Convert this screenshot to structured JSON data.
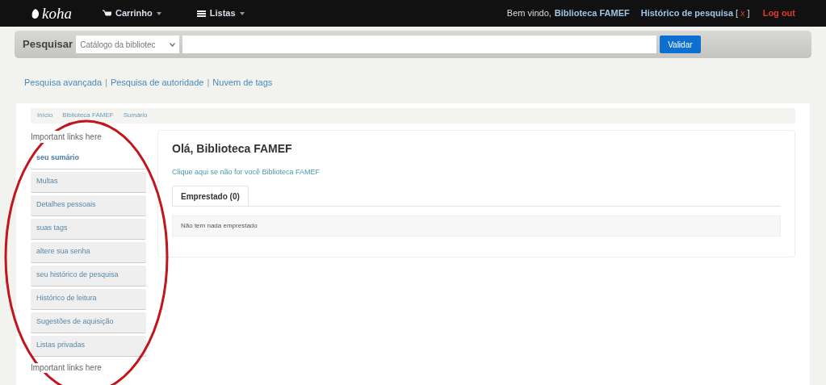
{
  "navbar": {
    "logo": "koha",
    "menus": [
      {
        "label": "Carrinho",
        "kind": "cart"
      },
      {
        "label": "Listas",
        "kind": "list"
      }
    ],
    "welcome": "Bem vindo,",
    "user": "Biblioteca FAMEF",
    "history": "Histórico de pesquisa",
    "history_clear_open": "[",
    "history_clear": "x",
    "history_clear_close": "]",
    "logout": "Log out"
  },
  "search": {
    "label": "Pesquisar",
    "scope": "Catálogo da bibliotec",
    "button": "Validar"
  },
  "search_links": [
    {
      "label": "Pesquisa avançada"
    },
    {
      "label": "Pesquisa de autoridade"
    },
    {
      "label": "Nuvem de tags"
    }
  ],
  "search_link_separator": "|",
  "breadcrumbs": [
    "Início",
    "Biblioteca FAMEF",
    "Sumário"
  ],
  "sidebar": {
    "heading": "Important links here",
    "items": [
      {
        "label": "seu sumário",
        "selected": true
      },
      {
        "label": "Multas",
        "selected": false
      },
      {
        "label": "Detalhes pessoais",
        "selected": false
      },
      {
        "label": "suas tags",
        "selected": false
      },
      {
        "label": "altere sua senha",
        "selected": false
      },
      {
        "label": "seu histórico de pesquisa",
        "selected": false
      },
      {
        "label": "Histórico de leitura",
        "selected": false
      },
      {
        "label": "Sugestões de aquisição",
        "selected": false
      },
      {
        "label": "Listas privadas",
        "selected": false
      }
    ],
    "footer": "Important links here"
  },
  "main": {
    "title": "Olá, Biblioteca FAMEF",
    "not_you": "Clique aqui se não for você Biblioteca FAMEF",
    "tabs": [
      {
        "label": "Emprestado (0)",
        "selected": true
      }
    ],
    "empty_message": "Não tem nada emprestado"
  },
  "annotation": {
    "kind": "ellipse",
    "color": "#c0161c"
  }
}
